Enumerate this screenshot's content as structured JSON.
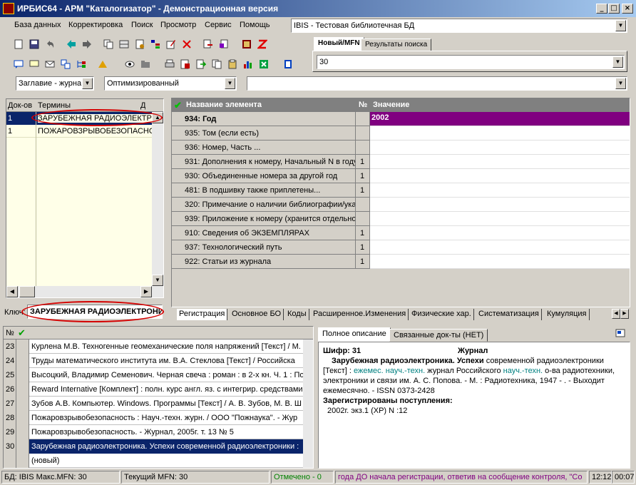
{
  "window": {
    "title": "ИРБИС64 - АРМ \"Каталогизатор\" - Демонстрационная версия"
  },
  "menu": [
    "База данных",
    "Корректировка",
    "Поиск",
    "Просмотр",
    "Сервис",
    "Помощь"
  ],
  "db_combo": {
    "value": "IBIS - Тестовая библиотечная БД"
  },
  "mfn_tabs": [
    "Новый/MFN",
    "Результаты поиска"
  ],
  "mfn_combo": {
    "value": "30"
  },
  "dict_combo": {
    "value": "Заглавие - журна"
  },
  "mode_combo": {
    "value": "Оптимизированный"
  },
  "dict": {
    "headers": [
      "Док-ов",
      "Термины",
      "Д"
    ],
    "rows": [
      {
        "count": "1",
        "term": "ЗАРУБЕЖНАЯ РАДИОЭЛЕКТР"
      },
      {
        "count": "1",
        "term": "ПОЖАРОВЗРЫВОБЕЗОПАСНО"
      }
    ],
    "key_label": "Ключ:",
    "key_value": "ЗАРУБЕЖНАЯ РАДИОЭЛЕКТРОНИ"
  },
  "editor": {
    "headers": [
      "Название элемента",
      "№",
      "Значение"
    ],
    "rows": [
      {
        "name": "934: Год",
        "num": "",
        "value": "2002",
        "selected": true
      },
      {
        "name": "935: Том (если есть)",
        "num": "",
        "value": ""
      },
      {
        "name": "936: Номер, Часть ...",
        "num": "",
        "value": ""
      },
      {
        "name": "931: Дополнения к номеру, Начальный N в году",
        "num": "1",
        "value": ""
      },
      {
        "name": "930: Объединенные номера за другой год",
        "num": "1",
        "value": ""
      },
      {
        "name": "481: В подшивку также приплетены...",
        "num": "1",
        "value": ""
      },
      {
        "name": "320: Примечание о наличии библиографии/указ",
        "num": "",
        "value": ""
      },
      {
        "name": "939: Приложение к номеру (хранится отдельно",
        "num": "",
        "value": ""
      },
      {
        "name": "910: Сведения  об ЭКЗЕМПЛЯРАХ",
        "num": "1",
        "value": ""
      },
      {
        "name": "937: Технологический путь",
        "num": "1",
        "value": ""
      },
      {
        "name": "922: Статьи из журнала",
        "num": "1",
        "value": ""
      }
    ]
  },
  "editor_tabs": [
    "Регистрация",
    "Основное БО",
    "Коды",
    "Расширенное.Изменения",
    "Физические хар.",
    "Систематизация",
    "Кумуляция"
  ],
  "records": {
    "header_num": "№",
    "rows": [
      {
        "n": "23",
        "text": "Курлена М.В. Техногенные геомеханические поля напряжений [Текст] / М."
      },
      {
        "n": "24",
        "text": "Труды математического института им. В.А. Стеклова [Текст] / Российска"
      },
      {
        "n": "25",
        "text": "Высоцкий, Владимир Семенович. Черная свеча : роман : в 2-х кн. Ч. 1 : По"
      },
      {
        "n": "26",
        "text": "Reward Internative [Комплект] : полн. курс англ. яз. с интегрир. средствами"
      },
      {
        "n": "27",
        "text": "Зубов А.В. Компьютер. Windows. Программы [Текст] / А. В. Зубов, М. В. Ш"
      },
      {
        "n": "28",
        "text": "Пожаровзрывобезопасность : Науч.-техн. журн. / ООО \"Пожнаука\". - Жур"
      },
      {
        "n": "29",
        "text": "Пожаровзрывобезопасность. - Журнал, 2005г. т. 13 № 5"
      },
      {
        "n": "30",
        "text": "Зарубежная радиоэлектроника. Успехи современной радиоэлектроники :",
        "selected": true
      },
      {
        "n": "",
        "text": "(новый)"
      }
    ]
  },
  "desc_tabs": [
    "Полное описание",
    "Связанные док-ты (НЕТ)"
  ],
  "desc": {
    "shifr_label": "Шифр: 31",
    "type": "Журнал",
    "title_line": "Зарубежная радиоэлектроника. Успехи",
    "line1_rest": " современной радиоэлектроники",
    "line2a": "[Текст] : ",
    "line2_hl": "ежемес. науч.-техн.",
    "line2b": " журнал Российского ",
    "line2_hl2": "науч.-техн.",
    "line2c": " о-ва радиотехники,",
    "line3": "электроники и связи им. А. С. Попова. - М. : Радиотехника, 1947 -      . - Выходит",
    "line4": "ежемесячно. - ISSN 0373-2428",
    "reg_label": "Зарегистрированы поступления:",
    "reg_value": "2002г. экз.1 (ХР) N :12"
  },
  "status": {
    "db": "БД: IBIS Макс.MFN: 30",
    "current": "Текущий MFN: 30",
    "marked": "Отмечено - 0",
    "message": "года ДО начала регистрации, ответив на сообщение контроля, \"Со",
    "time1": "12:12",
    "time2": "00:07"
  },
  "colors": {
    "title_start": "#0a246a",
    "title_end": "#a6caf0",
    "selection": "#0a246a",
    "value_row": "#800080",
    "highlight_oval": "#d40000",
    "desc_hl": "#008080",
    "status_green": "#008000",
    "status_purple": "#800080"
  }
}
